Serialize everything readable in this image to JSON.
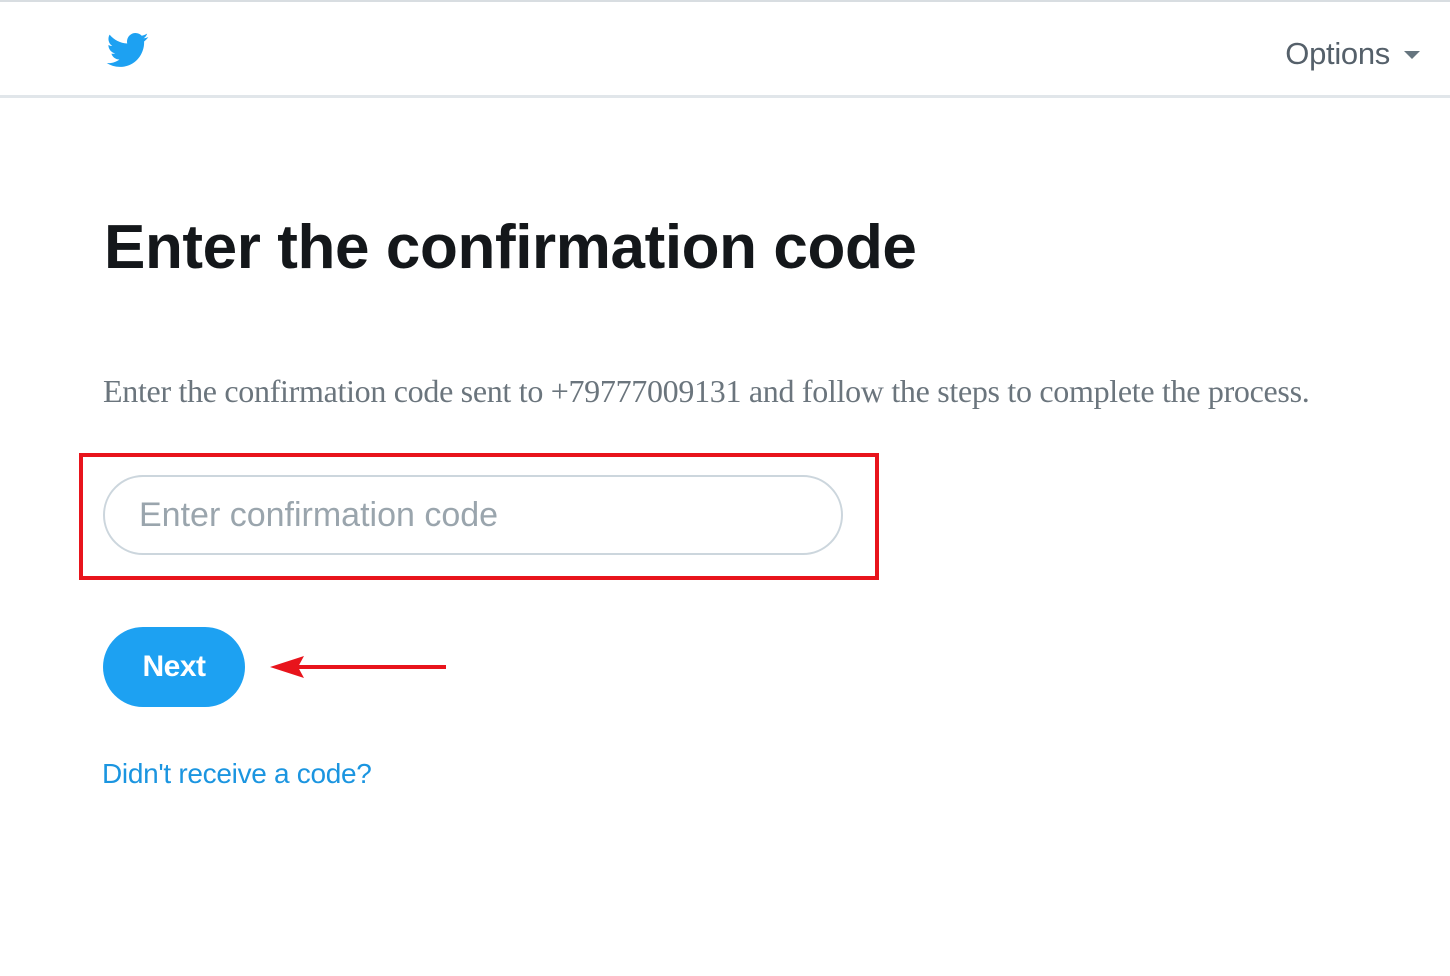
{
  "header": {
    "logo": "twitter-bird-icon",
    "options_label": "Options",
    "options_icon": "caret-down-icon"
  },
  "main": {
    "title": "Enter the confirmation code",
    "description": "Enter the confirmation code sent to +79777009131 and follow the steps to complete the process.",
    "code_input": {
      "placeholder": "Enter confirmation code",
      "value": ""
    },
    "next_label": "Next",
    "resend_link": "Didn't receive a code?"
  },
  "annotations": {
    "highlight_color": "#e8141c",
    "arrow_icon": "left-arrow-icon"
  },
  "colors": {
    "brand": "#1da1f2",
    "link": "#1b95e0",
    "title": "#14171a"
  }
}
